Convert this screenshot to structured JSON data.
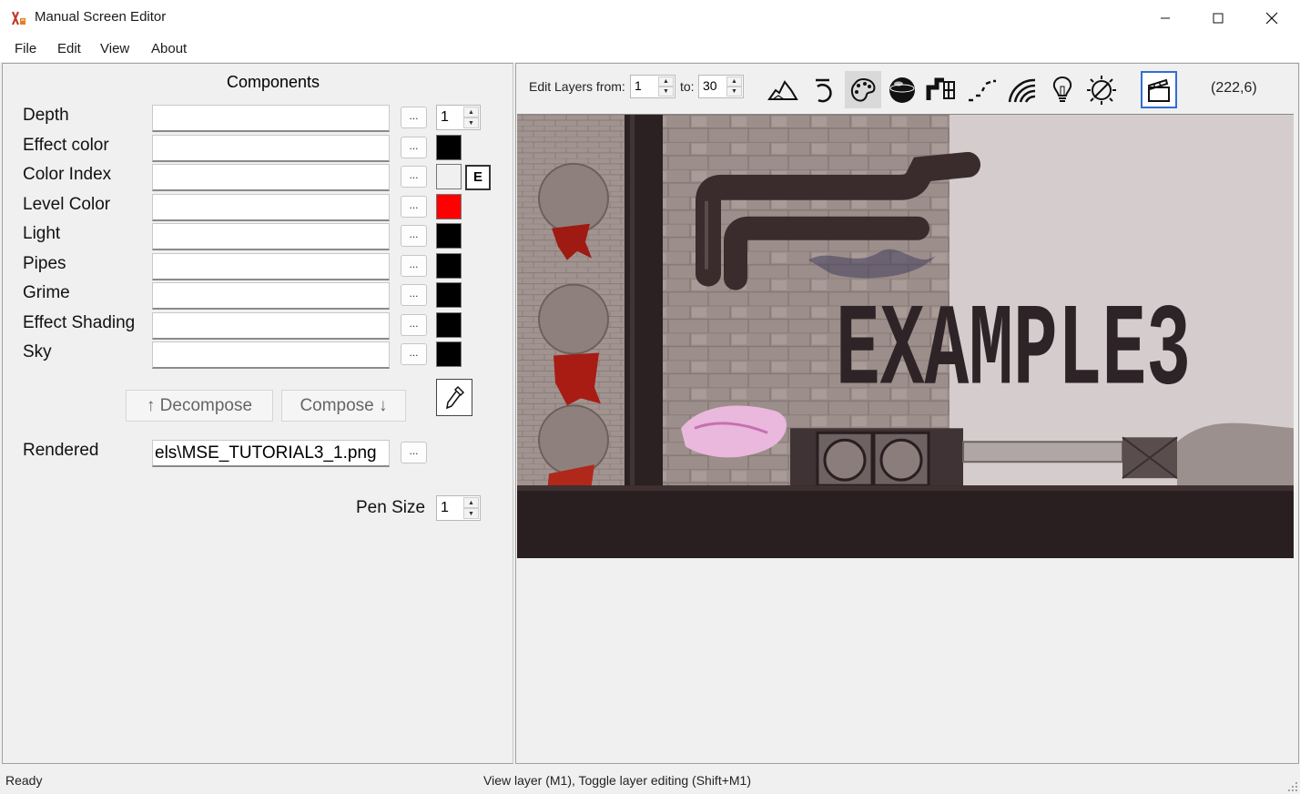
{
  "window": {
    "title": "Manual Screen Editor",
    "icon": "app-icon"
  },
  "menu": [
    "File",
    "Edit",
    "View",
    "About"
  ],
  "components": {
    "title": "Components",
    "rows": [
      {
        "label": "Depth",
        "value": "",
        "swatch": null
      },
      {
        "label": "Effect color",
        "value": "",
        "swatch": "#000000"
      },
      {
        "label": "Color Index",
        "value": "",
        "swatch": "#f0f0f0"
      },
      {
        "label": "Level Color",
        "value": "",
        "swatch": "#ff0000"
      },
      {
        "label": "Light",
        "value": "",
        "swatch": "#000000"
      },
      {
        "label": "Pipes",
        "value": "",
        "swatch": "#000000"
      },
      {
        "label": "Grime",
        "value": "",
        "swatch": "#000000"
      },
      {
        "label": "Effect Shading",
        "value": "",
        "swatch": "#000000"
      },
      {
        "label": "Sky",
        "value": "",
        "swatch": "#000000"
      }
    ],
    "browse_label": "...",
    "depth_spin": "1",
    "e_button": "E",
    "decompose_label": "↑ Decompose",
    "compose_label": "Compose ↓",
    "rendered_label": "Rendered",
    "rendered_value": "els\\MSE_TUTORIAL3_1.png",
    "pen_size_label": "Pen Size",
    "pen_size_value": "1"
  },
  "toolbar": {
    "edit_layers_label": "Edit Layers from:",
    "from_value": "1",
    "to_label": "to:",
    "to_value": "30",
    "tools": [
      "terrain-icon",
      "rotate-icon",
      "palette-icon",
      "sphere-icon",
      "pipes-icon",
      "dotted-line-icon",
      "rainbow-icon",
      "lightbulb-icon",
      "sun-icon",
      "clapperboard-icon"
    ],
    "active_tool": "palette-icon",
    "coordinates": "(222,6)"
  },
  "canvas": {
    "text": "EXAMPLE3",
    "colors": {
      "sky": "#d5cdcd",
      "wall": "#9b8d88",
      "ground": "#2a1f20",
      "pipe": "#3a2c2d",
      "blood": "#b31d14",
      "blossom": "#e9b8dc"
    }
  },
  "status": {
    "left": "Ready",
    "hint": "View layer (M1), Toggle layer editing (Shift+M1)"
  }
}
